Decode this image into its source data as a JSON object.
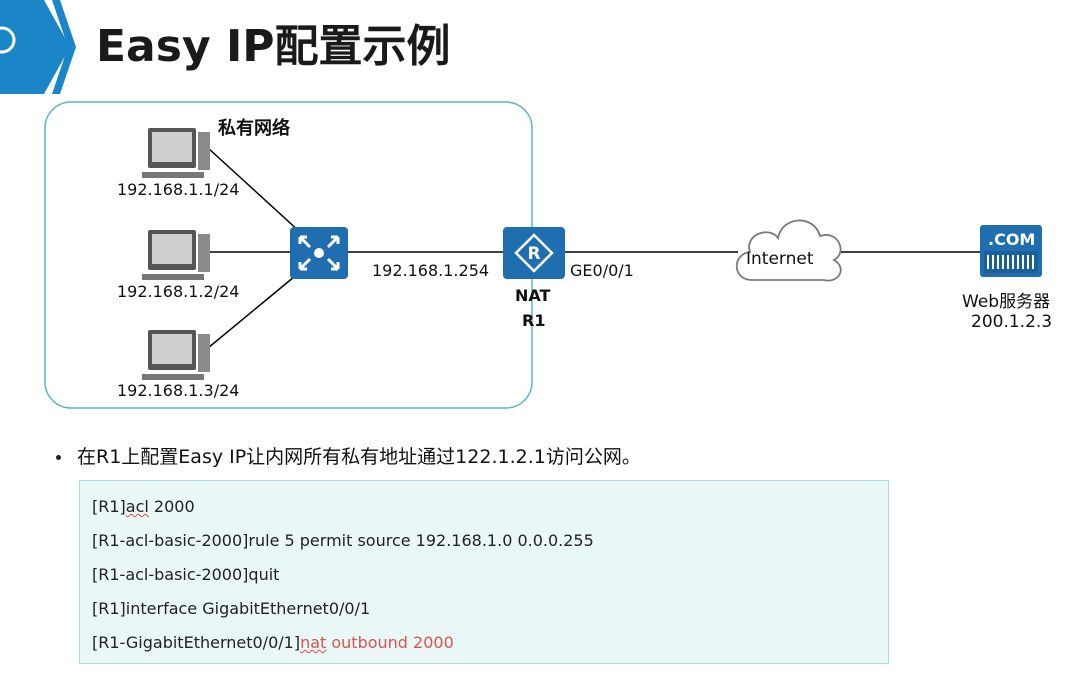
{
  "header": {
    "title": "Easy IP配置示例"
  },
  "diagram": {
    "private_network_label": "私有网络",
    "hosts": [
      {
        "ip": "192.168.1.1/24"
      },
      {
        "ip": "192.168.1.2/24"
      },
      {
        "ip": "192.168.1.3/24"
      }
    ],
    "router": {
      "inside_ip": "192.168.1.254",
      "outside_if": "GE0/0/1",
      "role_label": "NAT",
      "name": "R1"
    },
    "cloud_label": "Internet",
    "server": {
      "badge": ".COM",
      "label": "Web服务器",
      "ip": "200.1.2.3"
    }
  },
  "content": {
    "bullet": "在R1上配置Easy IP让内网所有私有地址通过122.1.2.1访问公网。",
    "code": {
      "line1_prefix": "[R1]",
      "line1_word": "acl",
      "line1_rest": " 2000",
      "line2": "[R1-acl-basic-2000]rule 5 permit source 192.168.1.0 0.0.0.255",
      "line3": "[R1-acl-basic-2000]quit",
      "line4": "[R1]interface GigabitEthernet0/0/1",
      "line5_prefix": "[R1-GigabitEthernet0/0/1]",
      "line5_word": "nat",
      "line5_rest": " outbound 2000"
    }
  },
  "colors": {
    "accent_blue": "#1f6fb0",
    "box_border": "#5bb3cf",
    "code_red": "#d9534f"
  }
}
